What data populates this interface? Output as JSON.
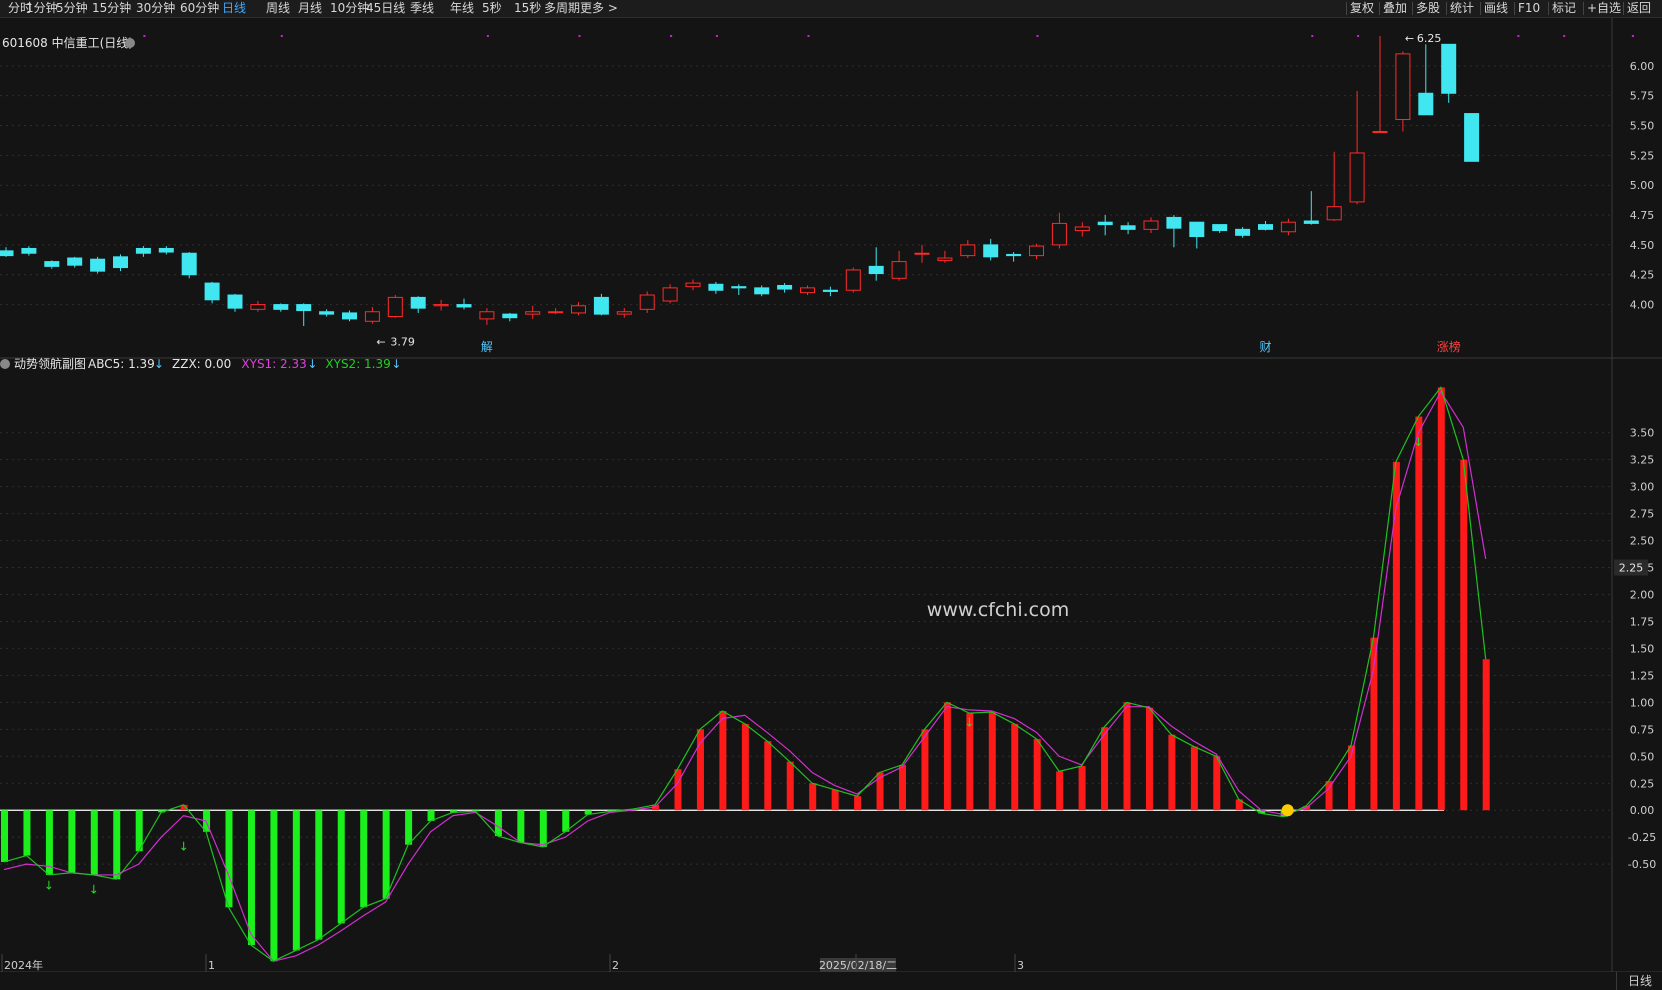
{
  "toolbar": {
    "left_items": [
      "分时",
      "1分钟",
      "5分钟",
      "15分钟",
      "30分钟",
      "60分钟",
      "日线",
      "周线",
      "月线",
      "10分钟",
      "45日线",
      "季线",
      "年线",
      "5秒",
      "15秒",
      "多周期",
      "更多 >"
    ],
    "active": "日线",
    "right_items": [
      "复权",
      "叠加",
      "多股",
      "统计",
      "画线",
      "F10",
      "标记",
      "+自选",
      "返回"
    ]
  },
  "main_panel": {
    "title": "601608 中信重工(日线)",
    "high_label": "6.25",
    "low_label": "3.79",
    "markers": [
      "解",
      "财",
      "涨榜"
    ],
    "yticks": [
      4.0,
      4.25,
      4.5,
      4.75,
      5.0,
      5.25,
      5.5,
      5.75,
      6.0
    ]
  },
  "indicator_panel": {
    "title": "动势领航副图",
    "legend": [
      {
        "label": "ABC5: 1.39",
        "arrow": "↓",
        "color": "#e6e6e6",
        "arrow_color": "#50c8ff"
      },
      {
        "label": "ZZX: 0.00",
        "arrow": "",
        "color": "#e6e6e6",
        "arrow_color": ""
      },
      {
        "label": "XYS1: 2.33",
        "arrow": "↓",
        "color": "#e040e0",
        "arrow_color": "#50c8ff"
      },
      {
        "label": "XYS2: 1.39",
        "arrow": "↓",
        "color": "#20d020",
        "arrow_color": "#50c8ff"
      }
    ],
    "current_value": "2.25",
    "yticks": [
      -0.5,
      -0.25,
      0.0,
      0.25,
      0.5,
      0.75,
      1.0,
      1.25,
      1.5,
      1.75,
      2.0,
      2.25,
      2.5,
      2.75,
      3.0,
      3.25,
      3.5
    ],
    "watermark": "www.cfchi.com"
  },
  "xaxis": {
    "labels": [
      "2024年",
      "1",
      "2",
      "2025/02/18/二",
      "3"
    ],
    "period": "日线"
  },
  "colors": {
    "up": "#ff2a2a",
    "down": "#40e6f0",
    "macd_up": "#ff1a1a",
    "macd_down": "#1cf01c",
    "xys1": "#d030d0",
    "xys2": "#20c020",
    "grid": "#2e2e2e"
  },
  "chart_data": {
    "type": "candlestick+bar",
    "price": {
      "open": [
        4.45,
        4.47,
        4.36,
        4.39,
        4.38,
        4.4,
        4.47,
        4.47,
        4.43,
        4.18,
        4.08,
        3.96,
        4.0,
        4.0,
        3.94,
        3.93,
        3.86,
        3.9,
        4.06,
        3.99,
        4.0,
        3.88,
        3.92,
        3.92,
        3.94,
        3.93,
        4.06,
        3.92,
        3.96,
        4.03,
        4.15,
        4.17,
        4.15,
        4.14,
        4.16,
        4.1,
        4.12,
        4.12,
        4.32,
        4.22,
        4.43,
        4.37,
        4.41,
        4.5,
        4.42,
        4.41,
        4.5,
        4.62,
        4.69,
        4.66,
        4.63,
        4.73,
        4.69,
        4.67,
        4.63,
        4.67,
        4.61,
        4.7,
        4.71,
        4.86,
        5.45,
        5.55,
        5.77,
        6.18,
        5.6
      ],
      "close": [
        4.41,
        4.43,
        4.32,
        4.33,
        4.28,
        4.31,
        4.43,
        4.44,
        4.25,
        4.04,
        3.97,
        4.0,
        3.96,
        3.95,
        3.92,
        3.88,
        3.94,
        4.06,
        3.97,
        4.0,
        3.98,
        3.94,
        3.89,
        3.94,
        3.94,
        3.99,
        3.92,
        3.94,
        4.08,
        4.14,
        4.18,
        4.12,
        4.14,
        4.09,
        4.13,
        4.14,
        4.11,
        4.29,
        4.26,
        4.36,
        4.43,
        4.39,
        4.5,
        4.4,
        4.41,
        4.49,
        4.68,
        4.65,
        4.67,
        4.63,
        4.7,
        4.64,
        4.57,
        4.62,
        4.58,
        4.63,
        4.69,
        4.68,
        4.82,
        5.27,
        5.45,
        6.1,
        5.59,
        5.77,
        5.2
      ],
      "high": [
        4.48,
        4.49,
        4.37,
        4.4,
        4.4,
        4.42,
        4.49,
        4.49,
        4.44,
        4.19,
        4.09,
        4.03,
        4.01,
        4.01,
        3.96,
        3.95,
        3.98,
        4.08,
        4.07,
        4.04,
        4.05,
        3.97,
        3.93,
        3.99,
        3.97,
        4.02,
        4.09,
        3.97,
        4.11,
        4.17,
        4.21,
        4.19,
        4.17,
        4.16,
        4.18,
        4.16,
        4.15,
        4.31,
        4.48,
        4.45,
        4.5,
        4.45,
        4.54,
        4.55,
        4.44,
        4.51,
        4.77,
        4.69,
        4.75,
        4.69,
        4.73,
        4.75,
        4.63,
        4.64,
        4.65,
        4.7,
        4.72,
        4.95,
        5.28,
        5.79,
        6.25,
        6.12,
        6.18,
        5.84,
        5.59
      ],
      "low": [
        4.4,
        4.41,
        4.3,
        4.31,
        4.26,
        4.28,
        4.4,
        4.42,
        4.22,
        4.01,
        3.94,
        3.94,
        3.94,
        3.82,
        3.9,
        3.86,
        3.84,
        3.89,
        3.93,
        3.95,
        3.96,
        3.83,
        3.86,
        3.88,
        3.92,
        3.91,
        3.91,
        3.89,
        3.93,
        4.01,
        4.12,
        4.09,
        4.08,
        4.07,
        4.1,
        4.08,
        4.07,
        4.1,
        4.2,
        4.2,
        4.35,
        4.35,
        4.39,
        4.37,
        4.36,
        4.38,
        4.47,
        4.57,
        4.58,
        4.59,
        4.6,
        4.48,
        4.47,
        4.6,
        4.56,
        4.62,
        4.58,
        4.67,
        4.7,
        4.84,
        5.45,
        5.45,
        5.61,
        5.69,
        5.2
      ]
    },
    "indicator": {
      "bars": [
        -0.48,
        -0.42,
        -0.6,
        -0.58,
        -0.6,
        -0.64,
        -0.38,
        -0.02,
        0.05,
        -0.2,
        -0.9,
        -1.25,
        -1.4,
        -1.3,
        -1.2,
        -1.05,
        -0.9,
        -0.82,
        -0.32,
        -0.1,
        -0.02,
        -0.01,
        -0.24,
        -0.3,
        -0.34,
        -0.2,
        -0.04,
        -0.01,
        0.01,
        0.05,
        0.38,
        0.75,
        0.92,
        0.8,
        0.64,
        0.45,
        0.25,
        0.19,
        0.13,
        0.35,
        0.42,
        0.75,
        1.0,
        0.9,
        0.91,
        0.8,
        0.66,
        0.36,
        0.41,
        0.77,
        1.0,
        0.95,
        0.7,
        0.59,
        0.5,
        0.1,
        -0.03,
        -0.06,
        0.04,
        0.27,
        0.6,
        1.6,
        3.23,
        3.65,
        3.92,
        3.25,
        1.4
      ],
      "xys1": [
        -0.55,
        -0.5,
        -0.52,
        -0.58,
        -0.6,
        -0.6,
        -0.5,
        -0.25,
        -0.05,
        -0.1,
        -0.6,
        -1.15,
        -1.4,
        -1.35,
        -1.25,
        -1.12,
        -0.98,
        -0.85,
        -0.5,
        -0.2,
        -0.05,
        -0.02,
        -0.15,
        -0.3,
        -0.32,
        -0.25,
        -0.1,
        -0.02,
        0.0,
        0.03,
        0.25,
        0.62,
        0.85,
        0.88,
        0.72,
        0.55,
        0.35,
        0.23,
        0.15,
        0.3,
        0.4,
        0.68,
        0.96,
        0.93,
        0.92,
        0.85,
        0.72,
        0.5,
        0.42,
        0.7,
        0.96,
        0.96,
        0.78,
        0.64,
        0.52,
        0.18,
        0.0,
        -0.04,
        0.02,
        0.2,
        0.5,
        1.3,
        2.8,
        3.5,
        3.88,
        3.55,
        2.33
      ],
      "xys2": [
        -0.48,
        -0.42,
        -0.6,
        -0.58,
        -0.6,
        -0.64,
        -0.38,
        -0.02,
        0.05,
        -0.2,
        -0.9,
        -1.25,
        -1.4,
        -1.3,
        -1.2,
        -1.05,
        -0.9,
        -0.82,
        -0.32,
        -0.1,
        -0.02,
        -0.01,
        -0.24,
        -0.3,
        -0.34,
        -0.2,
        -0.04,
        -0.01,
        0.01,
        0.05,
        0.38,
        0.75,
        0.92,
        0.8,
        0.64,
        0.45,
        0.25,
        0.19,
        0.13,
        0.35,
        0.42,
        0.75,
        1.0,
        0.9,
        0.91,
        0.8,
        0.66,
        0.36,
        0.41,
        0.77,
        1.0,
        0.95,
        0.7,
        0.59,
        0.5,
        0.1,
        -0.03,
        -0.06,
        0.04,
        0.27,
        0.6,
        1.6,
        3.23,
        3.65,
        3.92,
        3.25,
        1.4
      ]
    }
  }
}
